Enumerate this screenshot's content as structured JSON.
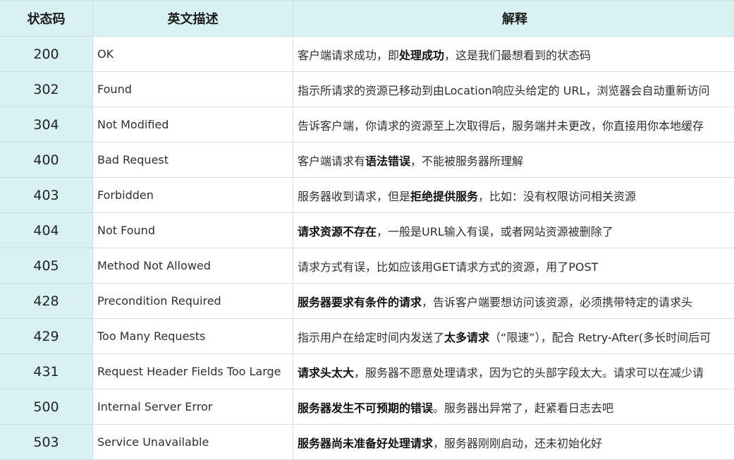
{
  "headers": {
    "code": "状态码",
    "name": "英文描述",
    "desc": "解释"
  },
  "rows": [
    {
      "code": "200",
      "name": "OK",
      "desc": [
        {
          "t": "客户端请求成功，即"
        },
        {
          "t": "处理成功",
          "b": true
        },
        {
          "t": "，这是我们最想看到的状态码"
        }
      ]
    },
    {
      "code": "302",
      "name": "Found",
      "desc": [
        {
          "t": "指示所请求的资源已移动到由Location响应头给定的 URL，浏览器会自动重新访问"
        }
      ]
    },
    {
      "code": "304",
      "name": "Not Modified",
      "desc": [
        {
          "t": "告诉客户端，你请求的资源至上次取得后，服务端并未更改，你直接用你本地缓存"
        }
      ]
    },
    {
      "code": "400",
      "name": "Bad Request",
      "desc": [
        {
          "t": "客户端请求有"
        },
        {
          "t": "语法错误",
          "b": true
        },
        {
          "t": "，不能被服务器所理解"
        }
      ]
    },
    {
      "code": "403",
      "name": "Forbidden",
      "desc": [
        {
          "t": "服务器收到请求，但是"
        },
        {
          "t": "拒绝提供服务",
          "b": true
        },
        {
          "t": "，比如：没有权限访问相关资源"
        }
      ]
    },
    {
      "code": "404",
      "name": "Not Found",
      "desc": [
        {
          "t": "请求资源不存在",
          "b": true
        },
        {
          "t": "，一般是URL输入有误，或者网站资源被删除了"
        }
      ]
    },
    {
      "code": "405",
      "name": "Method Not Allowed",
      "desc": [
        {
          "t": "请求方式有误，比如应该用GET请求方式的资源，用了POST"
        }
      ]
    },
    {
      "code": "428",
      "name": "Precondition Required",
      "desc": [
        {
          "t": "服务器要求有条件的请求",
          "b": true
        },
        {
          "t": "，告诉客户端要想访问该资源，必须携带特定的请求头"
        }
      ]
    },
    {
      "code": "429",
      "name": "Too Many Requests",
      "desc": [
        {
          "t": "指示用户在给定时间内发送了"
        },
        {
          "t": "太多请求",
          "b": true
        },
        {
          "t": "（“限速”），配合 Retry-After(多长时间后可"
        }
      ]
    },
    {
      "code": "431",
      "name": "Request Header Fields Too Large",
      "desc": [
        {
          "t": "请求头太大",
          "b": true
        },
        {
          "t": "，服务器不愿意处理请求，因为它的头部字段太大。请求可以在减少请"
        }
      ]
    },
    {
      "code": "500",
      "name": "Internal Server Error",
      "desc": [
        {
          "t": "服务器发生不可预期的错误",
          "b": true
        },
        {
          "t": "。服务器出异常了，赶紧看日志去吧"
        }
      ]
    },
    {
      "code": "503",
      "name": "Service Unavailable",
      "desc": [
        {
          "t": "服务器尚未准备好处理请求",
          "b": true
        },
        {
          "t": "，服务器刚刚启动，还未初始化好"
        }
      ]
    }
  ]
}
